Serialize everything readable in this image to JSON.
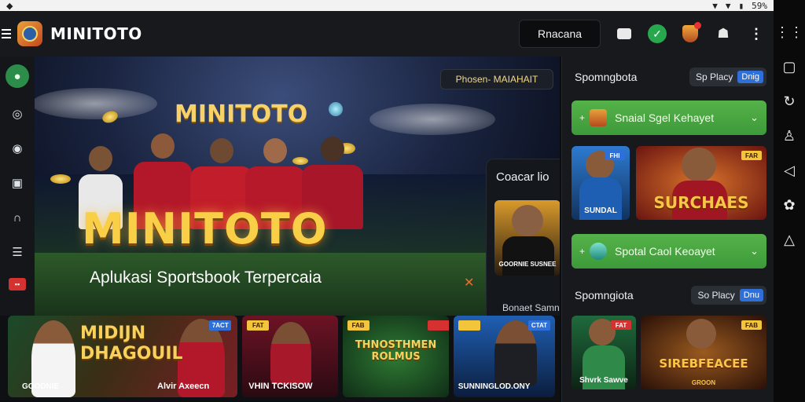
{
  "status_bar": {
    "right_text": "59%"
  },
  "header": {
    "brand": "MINITOTO",
    "search_button": "Rnacana"
  },
  "hero": {
    "title_top": "MINITOTO",
    "title": "MINITOTO",
    "subtitle": "Aplukasi Sportsbook Terpercaia",
    "tag": "Phosen- MAIAHAIT",
    "card_title": "Coacar lio",
    "card_caption": "GOORNIE SUSNEE",
    "card_line": "Bonaet Samn"
  },
  "promos": [
    {
      "title": "MIDIJN DHAGOUIL",
      "caption": "Alvir Axeecn",
      "badge": "7ACT",
      "left_caption": "GOODNIE"
    },
    {
      "title": "",
      "caption": "VHIN TCKISOW",
      "badge": "FAT"
    },
    {
      "title": "THNOSTHMEN ROLMUS",
      "caption": "",
      "badge": "FAB"
    },
    {
      "title": "",
      "caption": "SUNNINGLOD.ONY",
      "badge": "CTAT"
    }
  ],
  "right_panel": {
    "section1": {
      "title": "Spomngbota",
      "pill_label": "Sp Placy",
      "pill_tag": "Dnig"
    },
    "bar1": "Snaial Sgel Kehayet",
    "tiles1": [
      {
        "caption": "SUNDAL",
        "badge": "FHI"
      },
      {
        "big": "SURCHAES",
        "badge": "FAR"
      }
    ],
    "bar2": "Spotal Caol Keoayet",
    "section2": {
      "title": "Spomngiota",
      "pill_label": "So Placy",
      "pill_tag": "Dnu"
    },
    "tiles2": [
      {
        "caption": "Shvrk Sawve",
        "badge": "FAT"
      },
      {
        "big": "SIREBFEACEE",
        "small": "GROON",
        "badge": "FAB"
      }
    ]
  },
  "colors": {
    "accent_gold": "#f8cf47",
    "green": "#4ea944",
    "blue_tag": "#2e6fd8",
    "alert_red": "#d63131"
  }
}
